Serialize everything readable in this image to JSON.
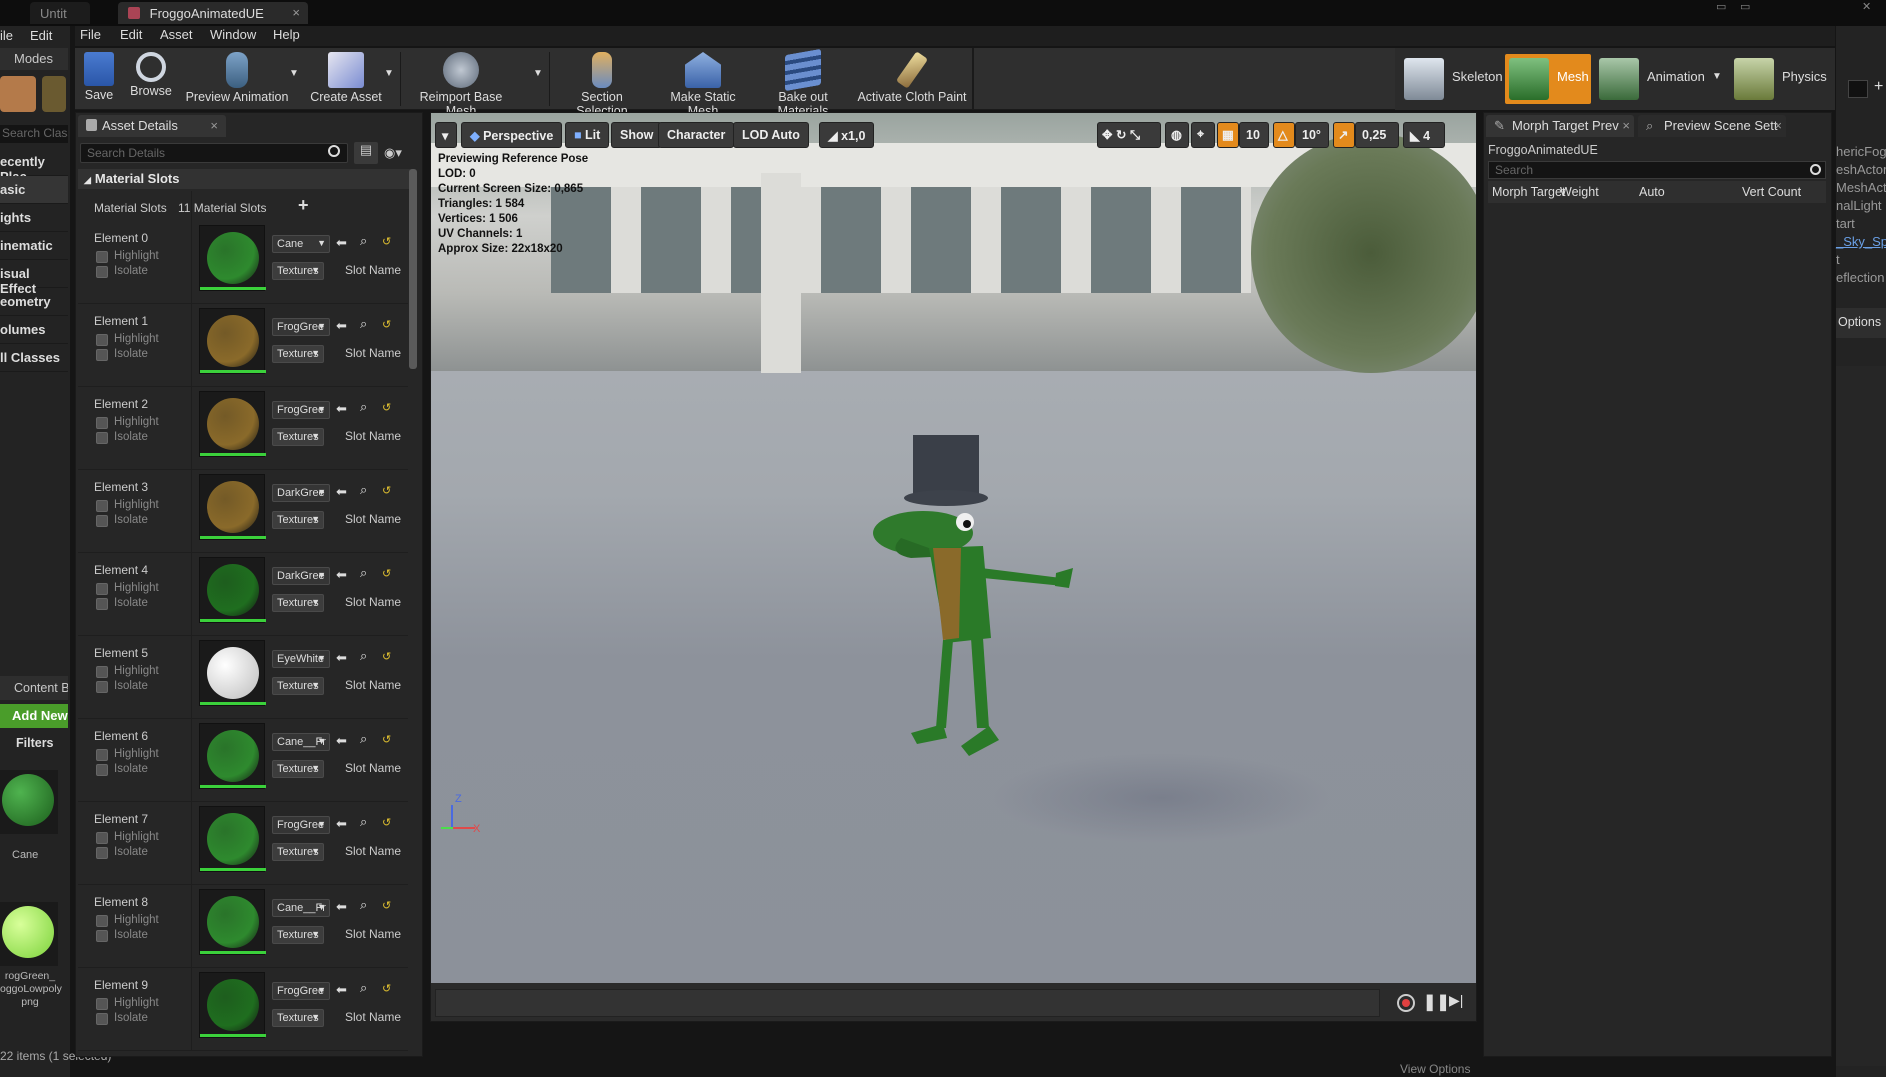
{
  "window_tabs": {
    "back_tab": "Untit",
    "active_tab": "FroggoAnimatedUE"
  },
  "menu": [
    "File",
    "Edit",
    "Asset",
    "Window",
    "Help"
  ],
  "back_menu": {
    "file": "ile",
    "edit": "Edit"
  },
  "back_modes": {
    "modes_label": "Modes",
    "search_placeholder": "Search Class",
    "categories": [
      "ecently Plac",
      "asic",
      "ights",
      "inematic",
      "isual Effect",
      "eometry",
      "olumes",
      "ll Classes"
    ],
    "content_browser": "Content B",
    "add_new": "Add New",
    "filters": "Filters",
    "assets": [
      {
        "label": "Cane"
      },
      {
        "label": "rogGreen_\noggoLowpoly\npng"
      }
    ],
    "status": "22 items (1 selected)"
  },
  "toolbar": {
    "buttons": [
      "Save",
      "Browse",
      "Preview Animation",
      "Create Asset",
      "Reimport Base Mesh",
      "Section Selection",
      "Make Static Mesh",
      "Bake out Materials",
      "Activate Cloth Paint"
    ]
  },
  "modes": {
    "skeleton": "Skeleton",
    "mesh": "Mesh",
    "animation": "Animation",
    "physics": "Physics"
  },
  "details": {
    "tab": "Asset Details",
    "search_placeholder": "Search Details",
    "section": "Material Slots",
    "slots_label": "Material Slots",
    "slots_count": "11 Material Slots",
    "highlight": "Highlight",
    "isolate": "Isolate",
    "textures": "Textures",
    "slot_name": "Slot Name",
    "elements": [
      {
        "label": "Element 0",
        "material": "Cane",
        "color": "#2e8a2e"
      },
      {
        "label": "Element 1",
        "material": "FrogGree",
        "color": "#8a6a2a"
      },
      {
        "label": "Element 2",
        "material": "FrogGree",
        "color": "#8a6a2a"
      },
      {
        "label": "Element 3",
        "material": "DarkGree",
        "color": "#8a6a2a"
      },
      {
        "label": "Element 4",
        "material": "DarkGree",
        "color": "#1f6e1f"
      },
      {
        "label": "Element 5",
        "material": "EyeWhite",
        "color": "#e6e6e6"
      },
      {
        "label": "Element 6",
        "material": "Cane__Fr",
        "color": "#2e8a2e"
      },
      {
        "label": "Element 7",
        "material": "FrogGree",
        "color": "#2e8a2e"
      },
      {
        "label": "Element 8",
        "material": "Cane__Fr",
        "color": "#2e8a2e"
      },
      {
        "label": "Element 9",
        "material": "FrogGree",
        "color": "#1f6e1f"
      }
    ]
  },
  "viewport": {
    "perspective": "Perspective",
    "lit": "Lit",
    "show": "Show",
    "character": "Character",
    "lod": "LOD Auto",
    "speed": "x1,0",
    "grid": "10",
    "angle": "10°",
    "scale": "0,25",
    "cam_speed": "4",
    "info": [
      "Previewing Reference Pose",
      "LOD: 0",
      "Current Screen Size: 0,865",
      "Triangles: 1 584",
      "Vertices: 1 506",
      "UV Channels: 1",
      "Approx Size: 22x18x20"
    ],
    "axis_z": "Z",
    "axis_x": "X"
  },
  "morph": {
    "tab": "Morph Target Prev",
    "tab2": "Preview Scene Sett",
    "asset": "FroggoAnimatedUE",
    "search_placeholder": "Search",
    "columns": [
      "Morph Target",
      "Weight",
      "Auto",
      "Vert Count"
    ]
  },
  "back_right": {
    "items": [
      "hericFog",
      "eshActor",
      "MeshActo",
      "nalLight",
      "tart",
      "_Sky_Sp",
      "t",
      "eflection"
    ],
    "options": "Options",
    "view_options": "View Options"
  }
}
